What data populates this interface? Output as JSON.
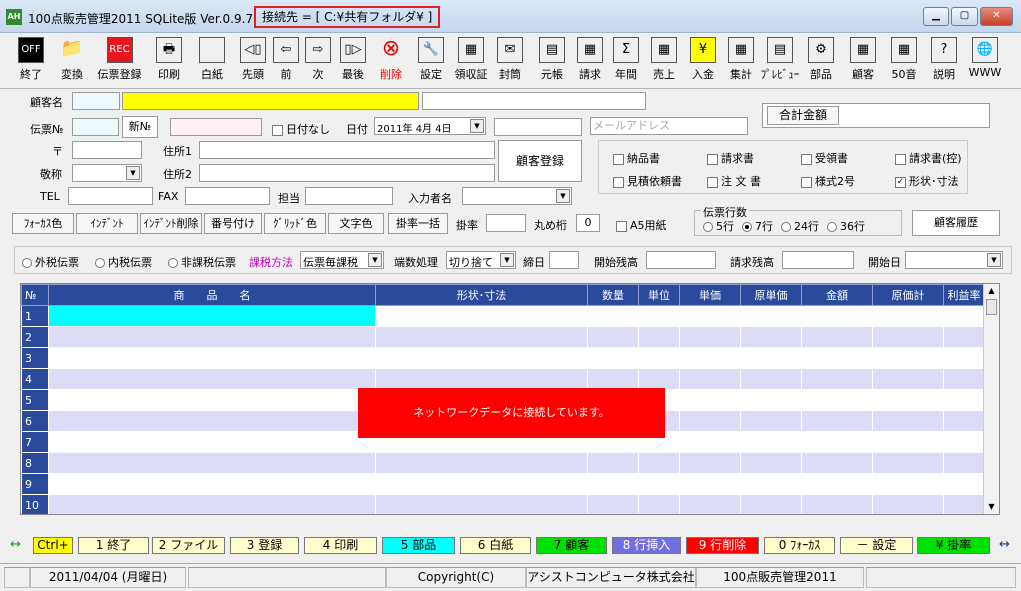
{
  "window": {
    "icon_text": "AH",
    "title": "100点販売管理2011 SQLite版 Ver.0.9.7",
    "connection": "接続先 = [ C:¥共有フォルダ¥ ]",
    "min": "▁",
    "max": "▢",
    "close": "✕"
  },
  "toolbar": [
    {
      "name": "exit",
      "label": "終了",
      "icon": "OFF"
    },
    {
      "name": "convert",
      "label": "変換",
      "icon": "📁"
    },
    {
      "name": "slip-register",
      "label": "伝票登録",
      "icon": "REC"
    },
    {
      "name": "print",
      "label": "印刷",
      "icon": "🖶"
    },
    {
      "name": "blank",
      "label": "白紙",
      "icon": ""
    },
    {
      "name": "first",
      "label": "先頭",
      "icon": "◁▯"
    },
    {
      "name": "prev",
      "label": "前",
      "icon": "⇦"
    },
    {
      "name": "next",
      "label": "次",
      "icon": "⇨"
    },
    {
      "name": "last",
      "label": "最後",
      "icon": "▯▷"
    },
    {
      "name": "delete",
      "label": "削除",
      "icon": "⊗"
    },
    {
      "name": "settings",
      "label": "設定",
      "icon": "🔧"
    },
    {
      "name": "receipt",
      "label": "領収証",
      "icon": "▦"
    },
    {
      "name": "envelope",
      "label": "封筒",
      "icon": "✉"
    },
    {
      "name": "ledger",
      "label": "元帳",
      "icon": "▤"
    },
    {
      "name": "invoice",
      "label": "請求",
      "icon": "▦"
    },
    {
      "name": "annual",
      "label": "年間",
      "icon": "Σ"
    },
    {
      "name": "sales",
      "label": "売上",
      "icon": "▦"
    },
    {
      "name": "payment",
      "label": "入金",
      "icon": "¥"
    },
    {
      "name": "total",
      "label": "集計",
      "icon": "▦"
    },
    {
      "name": "preview",
      "label": "ﾌﾟﾚﾋﾞｭｰ",
      "icon": "▤"
    },
    {
      "name": "parts",
      "label": "部品",
      "icon": "⚙"
    },
    {
      "name": "customer",
      "label": "顧客",
      "icon": "▦"
    },
    {
      "name": "kana50",
      "label": "50音",
      "icon": "▦"
    },
    {
      "name": "help",
      "label": "説明",
      "icon": "?"
    },
    {
      "name": "www",
      "label": "WWW",
      "icon": "🌐"
    }
  ],
  "form": {
    "customer_name_label": "顧客名",
    "slip_no_label": "伝票№",
    "new_no_btn": "新№",
    "no_date_label": "日付なし",
    "date_label": "日付",
    "date_value": "2011年 4月 4日",
    "email_placeholder": "メールアドレス",
    "total_amount_label": "合計金額",
    "postal_label": "〒",
    "address1_label": "住所1",
    "address2_label": "住所2",
    "honorific_label": "敬称",
    "customer_register_btn": "顧客登録",
    "tel_label": "TEL",
    "fax_label": "FAX",
    "staff_label": "担当",
    "inputter_label": "入力者名",
    "doc_checks": [
      {
        "name": "delivery-note",
        "label": "納品書",
        "checked": false
      },
      {
        "name": "invoice-doc",
        "label": "請求書",
        "checked": false
      },
      {
        "name": "receipt-doc",
        "label": "受領書",
        "checked": false
      },
      {
        "name": "invoice-copy",
        "label": "請求書(控)",
        "checked": false
      },
      {
        "name": "estimate-request",
        "label": "見積依頼書",
        "checked": false
      },
      {
        "name": "order-doc",
        "label": "注 文 書",
        "checked": false
      },
      {
        "name": "format2",
        "label": "様式2号",
        "checked": false
      },
      {
        "name": "shape-size",
        "label": "形状･寸法",
        "checked": true
      }
    ]
  },
  "toolbar2": {
    "focus_color": "ﾌｫｰｶｽ色",
    "indent": "ｲﾝﾃﾞﾝﾄ",
    "indent_delete": "ｲﾝﾃﾞﾝﾄ削除",
    "numbering": "番号付け",
    "grid_color": "ｸﾞﾘｯﾄﾞ色",
    "text_color": "文字色",
    "rate_all": "掛率一括",
    "rate_label": "掛率",
    "round_label": "丸め桁",
    "round_value": "0",
    "a5_label": "A5用紙",
    "slip_lines_label": "伝票行数",
    "lines": [
      {
        "label": "5行",
        "on": false
      },
      {
        "label": "7行",
        "on": true
      },
      {
        "label": "24行",
        "on": false
      },
      {
        "label": "36行",
        "on": false
      }
    ],
    "history_btn": "顧客履歴"
  },
  "tax": {
    "outer": "外税伝票",
    "inner": "内税伝票",
    "exempt": "非課税伝票",
    "method_label": "課税方法",
    "method_value": "伝票毎課税",
    "rounding_label": "端数処理",
    "rounding_value": "切り捨て",
    "closing_label": "締日",
    "start_balance_label": "開始残高",
    "invoice_balance_label": "請求残高",
    "start_date_label": "開始日"
  },
  "grid": {
    "headers": [
      "№",
      "商　　品　　名",
      "形状･寸法",
      "数量",
      "単位",
      "単価",
      "原単価",
      "金額",
      "原価計",
      "利益率"
    ],
    "rows": [
      "1",
      "2",
      "3",
      "4",
      "5",
      "6",
      "7",
      "8",
      "9",
      "10"
    ],
    "toast": "ネットワークデータに接続しています。"
  },
  "fkeys": [
    {
      "label": "Ctrl+",
      "bg": "#ffff00"
    },
    {
      "label": "1 終了",
      "bg": "#ffffcc"
    },
    {
      "label": "2 ファイル",
      "bg": "#ffffcc"
    },
    {
      "label": "3 登録",
      "bg": "#ffffcc"
    },
    {
      "label": "4 印刷",
      "bg": "#ffffcc"
    },
    {
      "label": "5 部品",
      "bg": "#00ffff"
    },
    {
      "label": "6 白紙",
      "bg": "#ffffcc"
    },
    {
      "label": "7 顧客",
      "bg": "#00e000"
    },
    {
      "label": "8 行挿入",
      "bg": "#7070e0"
    },
    {
      "label": "9 行削除",
      "bg": "#ff0000"
    },
    {
      "label": "0 ﾌｫｰｶｽ",
      "bg": "#ffffcc"
    },
    {
      "label": "－ 設定",
      "bg": "#ffffcc"
    },
    {
      "label": "¥ 掛率",
      "bg": "#00e000"
    }
  ],
  "arrows": {
    "left": "↔",
    "right": "↔"
  },
  "status": {
    "date": "2011/04/04 (月曜日)",
    "copyright": "Copyright(C)",
    "company": "アシストコンピュータ株式会社",
    "product": "100点販売管理2011"
  }
}
